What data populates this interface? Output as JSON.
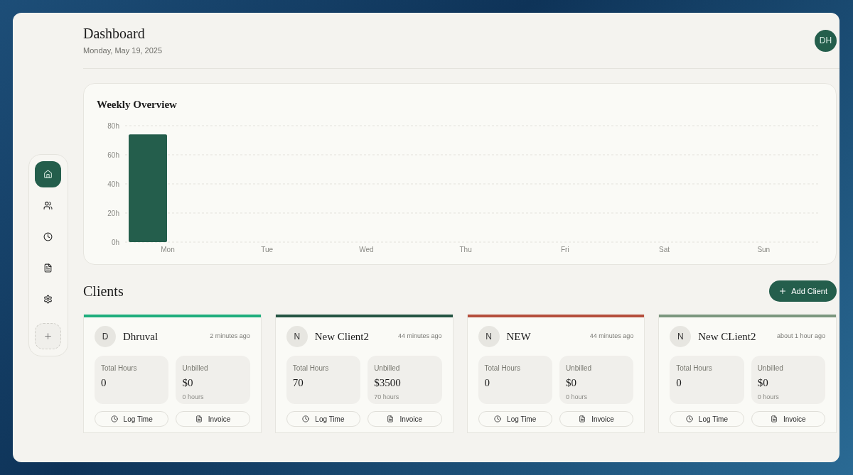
{
  "header": {
    "title": "Dashboard",
    "date": "Monday, May 19, 2025",
    "avatar": "DH"
  },
  "sidebar": {
    "items": [
      {
        "selected": true
      },
      {
        "selected": false
      },
      {
        "selected": false
      },
      {
        "selected": false
      },
      {
        "selected": false
      }
    ]
  },
  "weekly_overview": {
    "title": "Weekly Overview",
    "chart_data": {
      "type": "bar",
      "categories": [
        "Mon",
        "Tue",
        "Wed",
        "Thu",
        "Fri",
        "Sat",
        "Sun"
      ],
      "grid": true,
      "series": [
        {
          "color": "#245e4c",
          "values": [
            74,
            0,
            0,
            0,
            0,
            0,
            0
          ]
        }
      ],
      "ylim": [
        0,
        80
      ],
      "yticks": [
        {
          "value": 0,
          "label": "0h"
        },
        {
          "value": 20,
          "label": "20h"
        },
        {
          "value": 40,
          "label": "40h"
        },
        {
          "value": 60,
          "label": "60h"
        },
        {
          "value": 80,
          "label": "80h"
        }
      ]
    }
  },
  "clients": {
    "title": "Clients",
    "add_button": "Add Client",
    "cards": [
      {
        "initial": "D",
        "name": "Dhruval",
        "updated": "2 minutes ago",
        "color": "#1fae7d",
        "total_label": "Total Hours",
        "total": "0",
        "unbilled_label": "Unbilled",
        "unbilled": "$0",
        "unbilled_hours": "0 hours",
        "actions": [
          "Log Time",
          "Invoice"
        ]
      },
      {
        "initial": "N",
        "name": "New Client2",
        "updated": "44 minutes ago",
        "color": "#245443",
        "total_label": "Total Hours",
        "total": "70",
        "unbilled_label": "Unbilled",
        "unbilled": "$3500",
        "unbilled_hours": "70 hours",
        "actions": [
          "Log Time",
          "Invoice"
        ]
      },
      {
        "initial": "N",
        "name": "NEW",
        "updated": "44 minutes ago",
        "color": "#b54e3c",
        "total_label": "Total Hours",
        "total": "0",
        "unbilled_label": "Unbilled",
        "unbilled": "$0",
        "unbilled_hours": "0 hours",
        "actions": [
          "Log Time",
          "Invoice"
        ]
      },
      {
        "initial": "N",
        "name": "New CLient2",
        "updated": "about 1 hour ago",
        "color": "#7b977e",
        "total_label": "Total Hours",
        "total": "0",
        "unbilled_label": "Unbilled",
        "unbilled": "$0",
        "unbilled_hours": "0 hours",
        "actions": [
          "Log Time",
          "Invoice"
        ]
      }
    ]
  }
}
